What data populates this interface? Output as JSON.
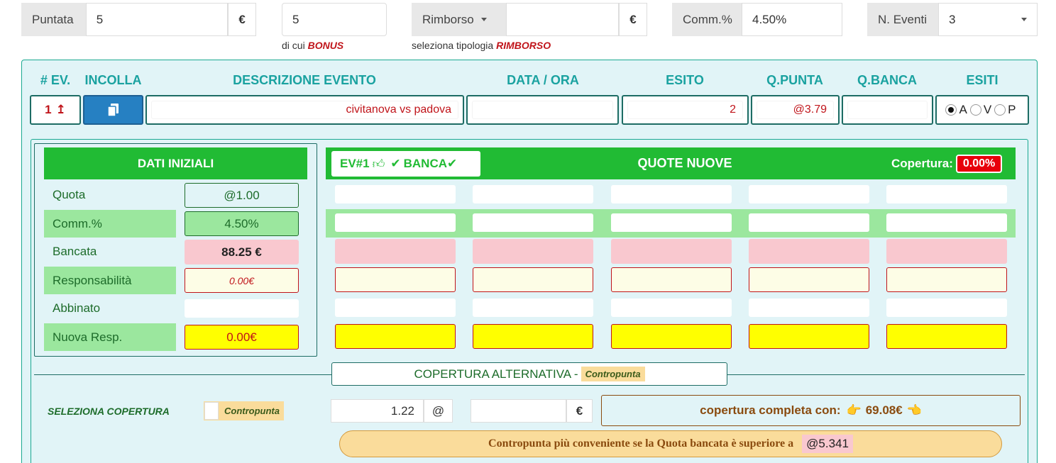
{
  "topbar": {
    "puntata_label": "Puntata",
    "puntata_value": "5",
    "currency": "€",
    "bonus_value": "5",
    "bonus_caption_prefix": "di cui",
    "bonus_caption_em": "BONUS",
    "rimborso_label": "Rimborso",
    "rimborso_value": "",
    "rimborso_caption_prefix": "seleziona tipologia",
    "rimborso_caption_em": "RIMBORSO",
    "comm_label": "Comm.%",
    "comm_value": "4.50%",
    "eventi_label": "N. Eventi",
    "eventi_value": "3"
  },
  "columns": {
    "ev": "# EV.",
    "incolla": "INCOLLA",
    "descrizione": "DESCRIZIONE EVENTO",
    "data_ora": "DATA / ORA",
    "esito": "ESITO",
    "q_punta": "Q.PUNTA",
    "q_banca": "Q.BANCA",
    "esiti": "ESITI"
  },
  "event_row": {
    "number": "1",
    "descrizione": "civitanova vs padova",
    "data_ora": "",
    "esito": "2",
    "q_punta": "@3.79",
    "q_banca": "",
    "esiti_options": [
      "A",
      "V",
      "P"
    ],
    "esiti_selected": "A"
  },
  "dati_iniziali": {
    "title": "DATI INIZIALI",
    "rows": [
      {
        "label": "Quota",
        "value": "@1.00"
      },
      {
        "label": "Comm.%",
        "value": "4.50%"
      },
      {
        "label": "Bancata",
        "value": "88.25 €"
      },
      {
        "label": "Responsabilità",
        "value": "0.00€"
      },
      {
        "label": "Abbinato",
        "value": ""
      },
      {
        "label": "Nuova Resp.",
        "value": "0.00€"
      }
    ]
  },
  "quote_nuove": {
    "tab_label": "EV#1",
    "tab_banca": "BANCA",
    "title": "QUOTE NUOVE",
    "copertura_label": "Copertura:",
    "copertura_value": "0.00%"
  },
  "alternativa": {
    "title": "COPERTURA ALTERNATIVA -",
    "title_badge": "Contropunta",
    "seleziona_label": "SELEZIONA COPERTURA",
    "toggle_label": "Contropunta",
    "quota_value": "1.22",
    "quota_addon": "@",
    "stake_value": "",
    "stake_addon": "€",
    "completa_text": "copertura completa con:",
    "completa_value": "69.08€",
    "conveniente_text": "Contropunta più conveniente se la Quota bancata è superiore a",
    "conveniente_value": "@5.341"
  },
  "colors": {
    "accent_green": "#21bb34",
    "panel_bg": "#e1f4f7",
    "teal_header": "#1aa2a0",
    "red": "#c0141a",
    "button_blue": "#2680c2"
  }
}
